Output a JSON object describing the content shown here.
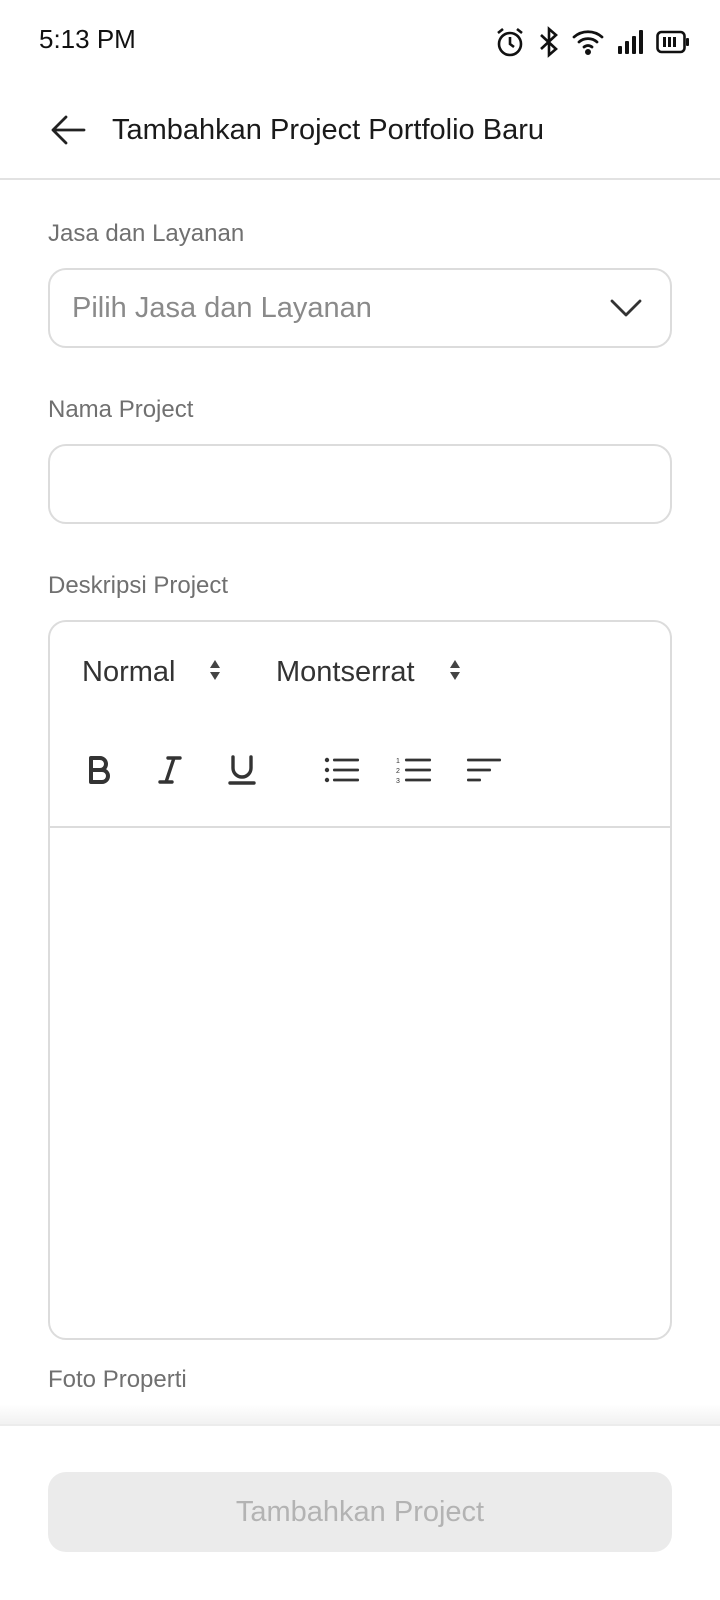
{
  "status_bar": {
    "time": "5:13 PM",
    "icons": [
      "alarm-icon",
      "bluetooth-icon",
      "wifi-icon",
      "signal-icon",
      "battery-icon"
    ]
  },
  "header": {
    "title": "Tambahkan Project Portfolio Baru",
    "back_icon": "arrow-left-icon"
  },
  "form": {
    "service": {
      "label": "Jasa dan Layanan",
      "placeholder": "Pilih Jasa dan Layanan"
    },
    "project_name": {
      "label": "Nama Project",
      "value": ""
    },
    "description": {
      "label": "Deskripsi Project",
      "heading_picker": "Normal",
      "font_picker": "Montserrat",
      "tools": [
        "bold-icon",
        "italic-icon",
        "underline-icon",
        "bullet-list-icon",
        "numbered-list-icon",
        "align-icon"
      ]
    },
    "photo": {
      "label": "Foto Properti"
    }
  },
  "footer": {
    "submit_label": "Tambahkan Project"
  },
  "colors": {
    "border": "#dcdcdc",
    "label": "#707070",
    "disabled_button_bg": "#ebebeb",
    "disabled_button_text": "#b3b3b3"
  }
}
